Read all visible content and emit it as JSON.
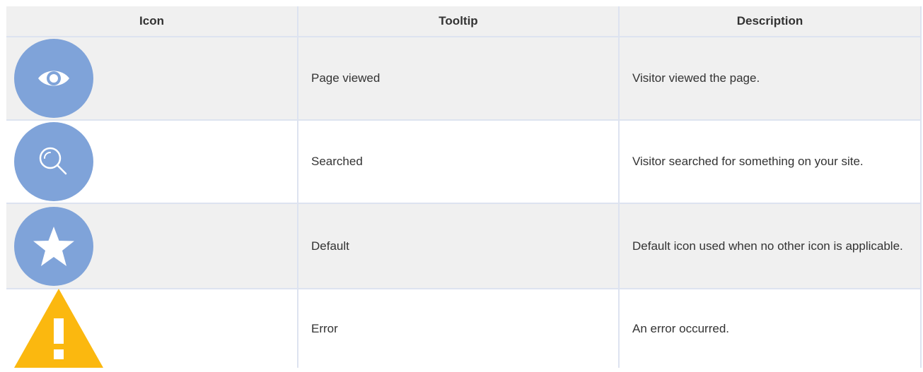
{
  "table": {
    "headers": {
      "icon": "Icon",
      "tooltip": "Tooltip",
      "description": "Description"
    },
    "rows": [
      {
        "icon": "eye-icon",
        "tooltip": "Page viewed",
        "description": "Visitor viewed the page."
      },
      {
        "icon": "search-icon",
        "tooltip": "Searched",
        "description": "Visitor searched for something on your site."
      },
      {
        "icon": "star-icon",
        "tooltip": "Default",
        "description": "Default icon used when no other icon is applicable."
      },
      {
        "icon": "warning-icon",
        "tooltip": "Error",
        "description": "An error occurred."
      }
    ]
  },
  "colors": {
    "icon_circle": "#7fa3d9",
    "warning": "#fbb80f",
    "header_bg": "#f0f0f0",
    "border": "#dde3f0"
  }
}
